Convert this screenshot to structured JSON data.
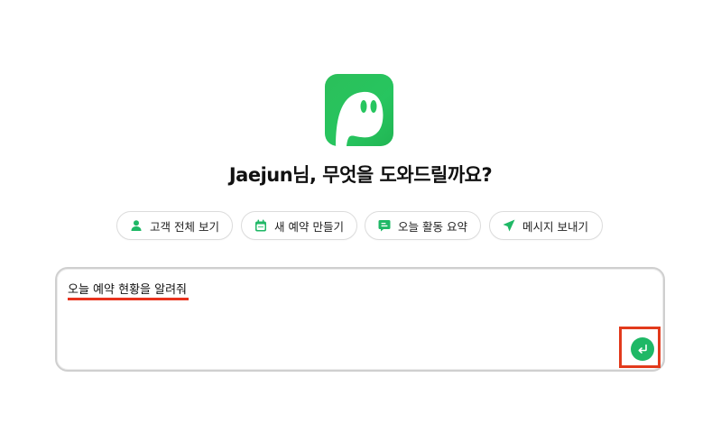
{
  "app": {
    "logo_icon": "ghost-logo-icon",
    "brand_color": "#27c55f"
  },
  "headline": "Jaejun님, 무엇을 도와드릴까요?",
  "quick_actions": [
    {
      "label": "고객 전체 보기",
      "icon": "person-icon"
    },
    {
      "label": "새 예약 만들기",
      "icon": "calendar-icon"
    },
    {
      "label": "오늘 활동 요약",
      "icon": "chat-summary-icon"
    },
    {
      "label": "메시지 보내기",
      "icon": "send-icon"
    }
  ],
  "prompt": {
    "value": "오늘 예약 현황을 알려줘",
    "send_icon": "enter-arrow-icon"
  },
  "annotation_colors": {
    "highlight": "#e23a1c"
  }
}
